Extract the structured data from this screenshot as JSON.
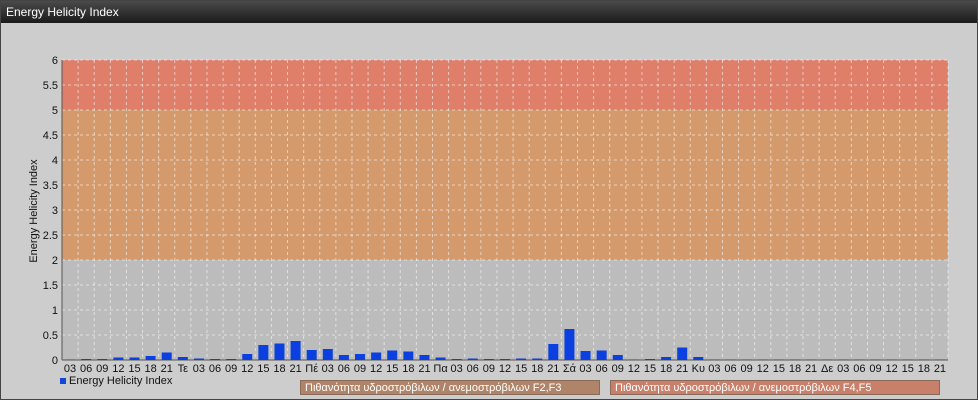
{
  "window": {
    "title": "Energy Helicity Index"
  },
  "colors": {
    "bar": "#0c3fe0",
    "band_low": "#bcbcbc",
    "band_mid": "#d59a6b",
    "band_high": "#df7f6a",
    "plot_bg": "#c4c4c4",
    "legend_f2": "#b08468",
    "legend_f4": "#c9806a"
  },
  "legend": {
    "series_label": "Energy Helicity Index",
    "band_f2f3": "Πιθανότητα υδροστρόβιλων / ανεμοστρόβιλων F2,F3",
    "band_f4f5": "Πιθανότητα υδροστρόβιλων / ανεμοστρόβιλων F4,F5"
  },
  "chart_data": {
    "type": "bar",
    "title": "Energy Helicity Index",
    "ylabel": "Energy Helicity Index",
    "xlabel": "",
    "ylim": [
      0,
      6
    ],
    "yticks": [
      "0",
      "0.5",
      "1",
      "1.5",
      "2",
      "2.5",
      "3",
      "3.5",
      "4",
      "4.5",
      "5",
      "5.5",
      "6"
    ],
    "bands": [
      {
        "from": 0,
        "to": 2,
        "label": ""
      },
      {
        "from": 2,
        "to": 5,
        "label": "Πιθανότητα υδροστρόβιλων / ανεμοστρόβιλων F2,F3"
      },
      {
        "from": 5,
        "to": 6,
        "label": "Πιθανότητα υδροστρόβιλων / ανεμοστρόβιλων F4,F5"
      }
    ],
    "categories": [
      "03",
      "06",
      "09",
      "12",
      "15",
      "18",
      "21",
      "Τε",
      "03",
      "06",
      "09",
      "12",
      "15",
      "18",
      "21",
      "Πέ",
      "03",
      "06",
      "09",
      "12",
      "15",
      "18",
      "21",
      "Πα",
      "03",
      "06",
      "09",
      "12",
      "15",
      "18",
      "21",
      "Σά",
      "03",
      "06",
      "09",
      "12",
      "15",
      "18",
      "21",
      "Κυ",
      "03",
      "06",
      "09",
      "12",
      "15",
      "18",
      "21",
      "Δε",
      "03",
      "06",
      "09",
      "12",
      "15",
      "18",
      "21"
    ],
    "series": [
      {
        "values": [
          0.01,
          0.02,
          0.02,
          0.05,
          0.05,
          0.08,
          0.15,
          0.06,
          0.03,
          0.02,
          0.02,
          0.12,
          0.3,
          0.33,
          0.38,
          0.2,
          0.22,
          0.1,
          0.12,
          0.15,
          0.19,
          0.17,
          0.1,
          0.05,
          0.02,
          0.03,
          0.02,
          0.02,
          0.03,
          0.03,
          0.32,
          0.62,
          0.18,
          0.19,
          0.1,
          0.01,
          0.02,
          0.06,
          0.25,
          0.06,
          0.01,
          0.01,
          0.01,
          0.01,
          0.01,
          0.01,
          0.01,
          0.01,
          0.01,
          0.01,
          0.01,
          0.01,
          0.01,
          0.01,
          0.01
        ]
      }
    ]
  }
}
